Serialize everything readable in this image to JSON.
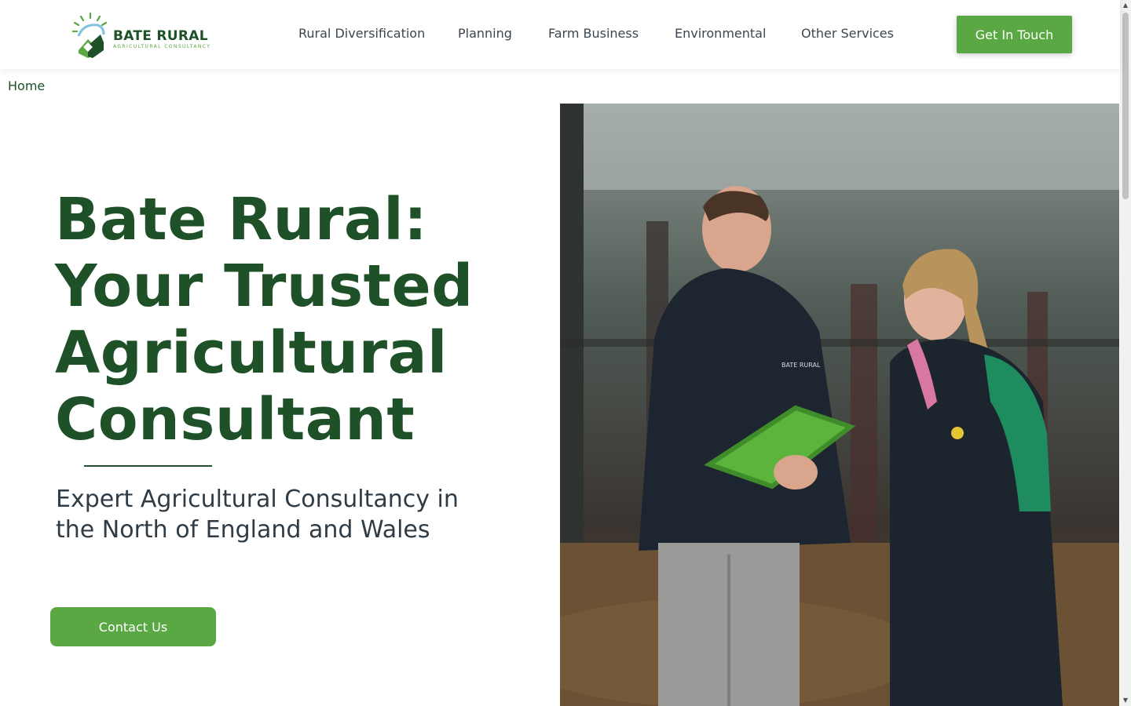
{
  "brand": {
    "name": "BATE RURAL",
    "tagline": "AGRICULTURAL CONSULTANCY",
    "colors": {
      "primary_green": "#1f5128",
      "accent_green": "#5aa843",
      "text": "#2f3b45"
    }
  },
  "nav": {
    "items": [
      {
        "label": "Rural Diversification"
      },
      {
        "label": "Planning"
      },
      {
        "label": "Farm Business"
      },
      {
        "label": "Environmental"
      },
      {
        "label": "Other Services"
      }
    ],
    "cta_label": "Get In Touch"
  },
  "breadcrumb": {
    "home": "Home"
  },
  "hero": {
    "title_lines": [
      "Bate Rural:",
      "Your Trusted",
      "Agricultural",
      "Consultant"
    ],
    "subtitle": "Expert Agricultural Consultancy in the North of England and Wales",
    "button_label": "Contact Us"
  },
  "photo": {
    "jacket_print": "BATE RURAL"
  },
  "icons": [
    "logo-sun-icon",
    "logo-house-icon",
    "scroll-up-arrow-icon",
    "scroll-down-arrow-icon"
  ]
}
